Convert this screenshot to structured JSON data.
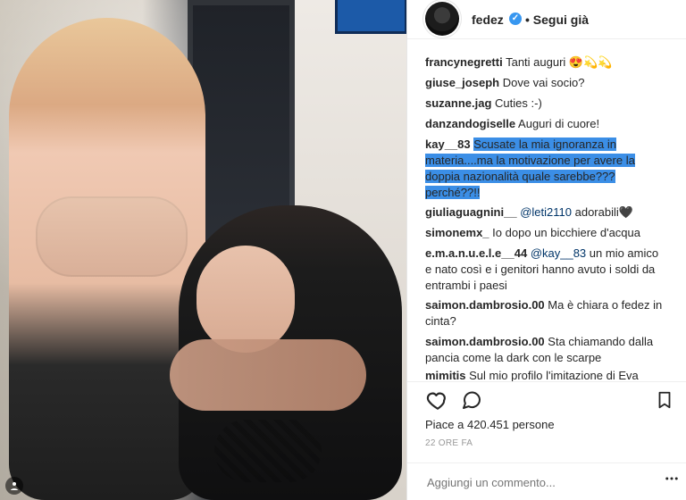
{
  "post": {
    "username": "fedez",
    "follow_label": "Segui già",
    "likes": "Piace a 420.451 persone",
    "time": "22 ORE FA"
  },
  "comments": [
    {
      "user": "francynegretti",
      "text": "Tanti auguri 😍💫💫"
    },
    {
      "user": "giuse_joseph",
      "text": "Dove vai socio?"
    },
    {
      "user": "suzanne.jag",
      "text": "Cuties :-)"
    },
    {
      "user": "danzandogiselle",
      "text": "Auguri di cuore!"
    },
    {
      "user": "kay__83",
      "text": "Scusate la mia ignoranza in materia....ma la motivazione per avere la doppia nazionalità quale sarebbe??? perché??!!"
    },
    {
      "user": "giuliaguagnini__",
      "mention": "@leti2110",
      "text": "adorabili🖤"
    },
    {
      "user": "simonemx_",
      "text": "Io dopo un bicchiere d'acqua"
    },
    {
      "user": "e.m.a.n.u.e.l.e__44",
      "mention": "@kay__83",
      "text": "un mio amico e nato così e i genitori hanno avuto i soldi da entrambi i paesi"
    },
    {
      "user": "saimon.dambrosio.00",
      "text": "Ma è chiara o fedez in cinta?"
    },
    {
      "user": "saimon.dambrosio.00",
      "text": "Sta chiamando dalla pancia come la dark con le scarpe"
    },
    {
      "user": "mimitis",
      "text": "Sul mio profilo l'imitazione di Eva"
    }
  ],
  "add_comment_placeholder": "Aggiungi un commento...",
  "icons": {
    "like": "heart-icon",
    "comment": "comment-icon",
    "save": "bookmark-icon",
    "more": "more-icon",
    "verified": "verified-badge-icon",
    "user_tag": "user-tag-icon"
  },
  "colors": {
    "verified": "#3897f0",
    "selection": "#3b8ee6",
    "link": "#003569",
    "muted": "#999999"
  }
}
